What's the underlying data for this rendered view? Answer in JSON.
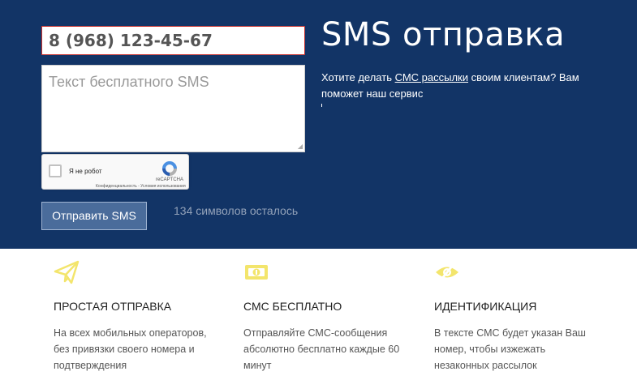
{
  "form": {
    "phone_value": "8 (968) 123-45-67",
    "message_placeholder": "Текст бесплатного SMS",
    "captcha": {
      "checkbox_label": "Я не робот",
      "brand": "reCAPTCHA",
      "links": "Конфиденциальность - Условия использования"
    },
    "send_button": "Отправить SMS",
    "remaining": "134 символов осталось"
  },
  "hero": {
    "title": "SMS отправка",
    "desc_before": "Хотите делать ",
    "desc_link": "СМС рассылки",
    "desc_after": " своим клиентам? Вам поможет наш сервис"
  },
  "features": [
    {
      "icon": "paper-plane-icon",
      "title": "ПРОСТАЯ ОТПРАВКА",
      "text": "На всех мобильных операторов, без привязки своего номера и подтверждения"
    },
    {
      "icon": "money-icon",
      "title": "СМС БЕСПЛАТНО",
      "text": "Отправляйте СМС-сообщения абсолютно бесплатно каждые 60 минут"
    },
    {
      "icon": "eye-icon",
      "title": "ИДЕНТИФИКАЦИЯ",
      "text": "В тексте СМС будет указан Ваш номер, чтобы изжежать незаконных рассылок"
    }
  ],
  "colors": {
    "hero_bg": "#123466",
    "accent_yellow": "#f3e56c",
    "button_bg": "#4a6c9b"
  }
}
